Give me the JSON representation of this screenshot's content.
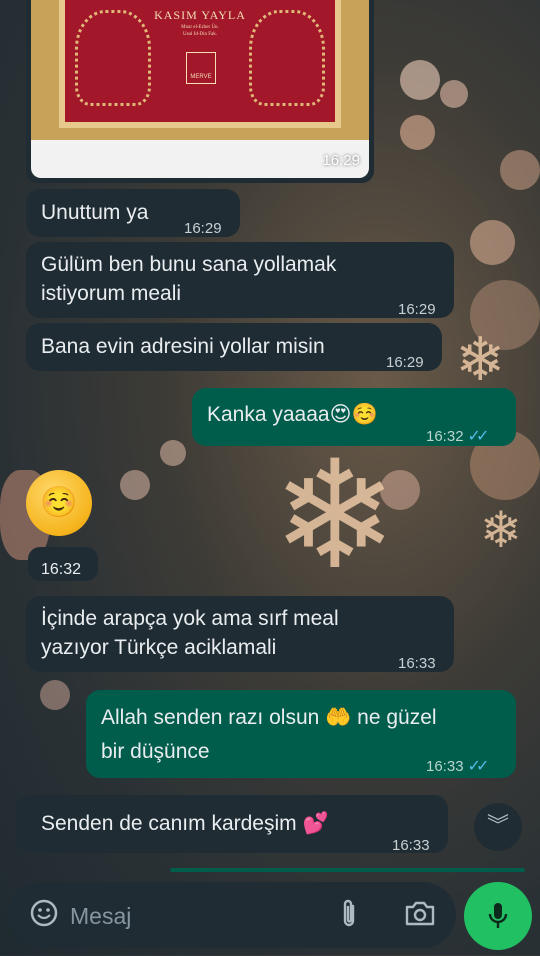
{
  "image_message": {
    "book_author": "KASIM YAYLA",
    "book_subtitle": "Mısır el-Ezher Ün.\nUsul Id-Din Fak.",
    "book_publisher": "MERVE",
    "time": "16:29"
  },
  "messages": [
    {
      "text": "Unuttum ya",
      "time": "16:29",
      "direction": "in"
    },
    {
      "text": "Gülüm ben bunu sana yollamak istiyorum meali",
      "line1": "Gülüm ben bunu sana yollamak",
      "line2": "istiyorum meali",
      "time": "16:29",
      "direction": "in"
    },
    {
      "text": "Bana evin adresini yollar misin",
      "time": "16:29",
      "direction": "in"
    },
    {
      "text": "Kanka yaaaa",
      "emoji": "😍☺️",
      "time": "16:32",
      "direction": "out",
      "status": "read"
    },
    {
      "emoji": "☺️",
      "time": "16:32",
      "direction": "in"
    },
    {
      "text": "İçinde arapça yok ama sırf meal yazıyor Türkçe aciklamali",
      "line1": "İçinde arapça yok ama sırf meal",
      "line2": "yazıyor Türkçe aciklamali",
      "time": "16:33",
      "direction": "in"
    },
    {
      "text": "Allah senden razı olsun 🤲 ne güzel bir düşünce",
      "line1_pre": "Allah senden razı olsun",
      "line1_emoji": "🤲",
      "line1_post": "ne güzel",
      "line2": "bir düşünce",
      "time": "16:33",
      "direction": "out",
      "status": "read"
    },
    {
      "text": "Senden de canım kardeşim",
      "emoji": "💕",
      "time": "16:33",
      "direction": "in"
    }
  ],
  "ticks": "✓✓",
  "icons": {
    "scroll_down": "chevron-double-down-icon",
    "emoji": "emoji-icon",
    "attach": "paperclip-icon",
    "camera": "camera-icon",
    "mic": "microphone-icon"
  },
  "input": {
    "placeholder": "Mesaj",
    "value": ""
  },
  "colors": {
    "incoming_bubble": "#1f2c33",
    "outgoing_bubble": "#005c4b",
    "read_ticks": "#53bdeb",
    "mic_button": "#21c063"
  }
}
